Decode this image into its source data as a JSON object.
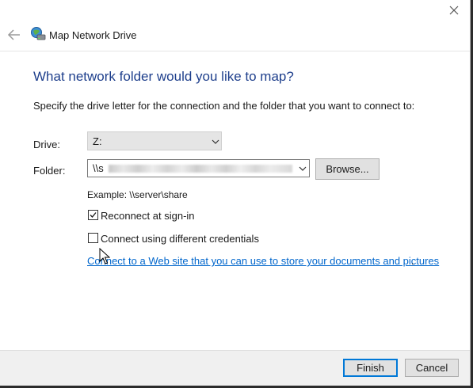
{
  "window": {
    "title": "Map Network Drive",
    "heading": "What network folder would you like to map?",
    "instruction": "Specify the drive letter for the connection and the folder that you want to connect to:"
  },
  "icons": {
    "back": "back-arrow-icon",
    "app": "network-drive-icon",
    "close": "close-icon",
    "dropdown": "chevron-down-icon",
    "cursor": "mouse-pointer-icon"
  },
  "form": {
    "drive_label": "Drive:",
    "drive_value": "Z:",
    "folder_label": "Folder:",
    "folder_value_visible": "\\\\s",
    "browse_label": "Browse...",
    "example_text": "Example: \\\\server\\share",
    "reconnect_label": "Reconnect at sign-in",
    "reconnect_checked": true,
    "credentials_label": "Connect using different credentials",
    "credentials_checked": false,
    "web_link_text": "Connect to a Web site that you can use to store your documents and pictures",
    "web_link_suffix": "."
  },
  "footer": {
    "finish_label": "Finish",
    "cancel_label": "Cancel"
  },
  "colors": {
    "heading": "#1e3f8c",
    "link": "#0066cc",
    "focus_border": "#0078d7",
    "footer_bg": "#f0f0f0"
  }
}
